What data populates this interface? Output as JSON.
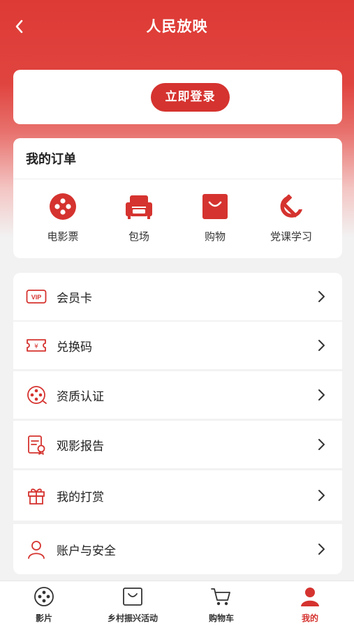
{
  "header": {
    "title": "人民放映"
  },
  "login": {
    "button_label": "立即登录"
  },
  "orders": {
    "title": "我的订单",
    "items": [
      {
        "label": "电影票",
        "icon": "film-reel-icon"
      },
      {
        "label": "包场",
        "icon": "sofa-icon"
      },
      {
        "label": "购物",
        "icon": "shopping-bag-icon"
      },
      {
        "label": "党课学习",
        "icon": "hammer-sickle-icon"
      }
    ]
  },
  "menu": {
    "items": [
      {
        "label": "会员卡",
        "icon": "vip-card-icon"
      },
      {
        "label": "兑换码",
        "icon": "coupon-icon"
      },
      {
        "label": "资质认证",
        "icon": "certification-icon"
      },
      {
        "label": "观影报告",
        "icon": "report-icon"
      },
      {
        "label": "我的打赏",
        "icon": "gift-icon"
      },
      {
        "label": "账户与安全",
        "icon": "user-icon"
      }
    ],
    "vip_badge": "VIP",
    "coupon_symbol": "¥"
  },
  "tabbar": {
    "items": [
      {
        "label": "影片",
        "icon": "film-reel-icon",
        "active": false
      },
      {
        "label": "乡村振兴活动",
        "icon": "shopping-bag-icon",
        "active": false
      },
      {
        "label": "购物车",
        "icon": "cart-icon",
        "active": false
      },
      {
        "label": "我的",
        "icon": "profile-icon",
        "active": true
      }
    ]
  },
  "colors": {
    "primary": "#d5332f",
    "background": "#f2f2f2"
  }
}
